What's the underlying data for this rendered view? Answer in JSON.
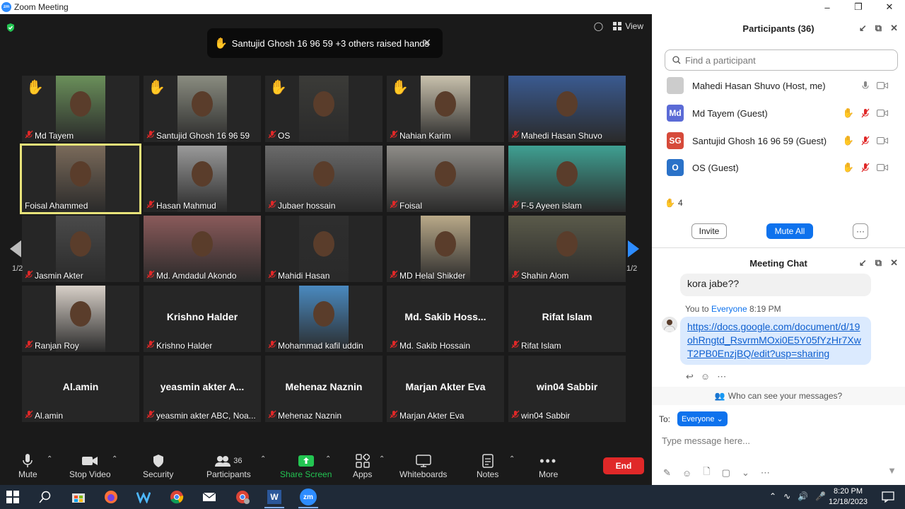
{
  "window": {
    "title": "Zoom Meeting",
    "logo": "zm"
  },
  "meeting": {
    "view_label": "View",
    "raised_banner": "Santujid Ghosh 16 96 59 +3 others raised hands",
    "page_left": "1/2",
    "page_right": "1/2",
    "tiles": [
      {
        "name": "Md Tayem",
        "hand": true,
        "video": true,
        "color": "#6a8f5a"
      },
      {
        "name": "Santujid Ghosh 16 96 59",
        "hand": true,
        "video": true,
        "color": "#8a8c80"
      },
      {
        "name": "OS",
        "hand": true,
        "video": true,
        "color": "#3b3b38"
      },
      {
        "name": "Nahian Karim",
        "hand": true,
        "video": true,
        "color": "#c9c1ad"
      },
      {
        "name": "Mahedi Hasan Shuvo",
        "hand": false,
        "video": true,
        "color": "#3a5a90"
      },
      {
        "name": "Foisal Ahammed",
        "hand": false,
        "video": true,
        "color": "#7a6a5a",
        "active": true
      },
      {
        "name": "Hasan Mahmud",
        "hand": false,
        "video": true,
        "color": "#9a9a9a"
      },
      {
        "name": "Jubaer hossain",
        "hand": false,
        "video": true,
        "color": "#6a6a6a"
      },
      {
        "name": "Foisal",
        "hand": false,
        "video": true,
        "color": "#8e8c88"
      },
      {
        "name": "F-5 Ayeen islam",
        "hand": false,
        "video": true,
        "color": "#3fa092"
      },
      {
        "name": "Jasmin Akter",
        "hand": false,
        "video": true,
        "color": "#4a4a4a"
      },
      {
        "name": "Md. Amdadul Akondo",
        "hand": false,
        "video": true,
        "color": "#8a5a5a"
      },
      {
        "name": "Mahidi Hasan",
        "hand": false,
        "video": true,
        "color": "#2e2e2e"
      },
      {
        "name": "MD Helal Shikder",
        "hand": false,
        "video": true,
        "color": "#b9a989"
      },
      {
        "name": "Shahin Alom",
        "hand": false,
        "video": true,
        "color": "#5a5a4a"
      },
      {
        "name": "Ranjan Roy",
        "hand": false,
        "video": true,
        "color": "#d8d0c8"
      },
      {
        "name": "Krishno Halder",
        "hand": false,
        "video": false,
        "big": "Krishno Halder"
      },
      {
        "name": "Mohammad kafil uddin",
        "hand": false,
        "video": true,
        "color": "#4a8ac0"
      },
      {
        "name": "Md. Sakib Hossain",
        "hand": false,
        "video": false,
        "big": "Md. Sakib Hoss..."
      },
      {
        "name": "Rifat Islam",
        "hand": false,
        "video": false,
        "big": "Rifat Islam"
      },
      {
        "name": "Al.amin",
        "hand": false,
        "video": false,
        "big": "Al.amin"
      },
      {
        "name": "yeasmin akter ABC, Noa...",
        "hand": false,
        "video": false,
        "big": "yeasmin akter A..."
      },
      {
        "name": "Mehenaz Naznin",
        "hand": false,
        "video": false,
        "big": "Mehenaz Naznin"
      },
      {
        "name": "Marjan Akter Eva",
        "hand": false,
        "video": false,
        "big": "Marjan Akter Eva"
      },
      {
        "name": "win04 Sabbir",
        "hand": false,
        "video": false,
        "big": "win04 Sabbir"
      }
    ]
  },
  "toolbar": {
    "mute": "Mute",
    "stop_video": "Stop Video",
    "security": "Security",
    "participants": "Participants",
    "participants_count": "36",
    "share_screen": "Share Screen",
    "apps": "Apps",
    "whiteboards": "Whiteboards",
    "notes": "Notes",
    "more": "More",
    "end": "End"
  },
  "participants_panel": {
    "title": "Participants (36)",
    "search_placeholder": "Find a participant",
    "rows": [
      {
        "name": "Mahedi Hasan Shuvo (Host, me)",
        "avatar": "",
        "color": "#cccccc",
        "hand": false
      },
      {
        "name": "Md Tayem (Guest)",
        "avatar": "Md",
        "color": "#5b6bd6",
        "hand": true
      },
      {
        "name": "Santujid Ghosh 16 96 59 (Guest)",
        "avatar": "SG",
        "color": "#d64a3a",
        "hand": true
      },
      {
        "name": "OS (Guest)",
        "avatar": "O",
        "color": "#2a72c8",
        "hand": true
      }
    ],
    "hands_count": "4",
    "invite": "Invite",
    "mute_all": "Mute All",
    "more": "···"
  },
  "chat_panel": {
    "title": "Meeting Chat",
    "prev_message": "kora jabe??",
    "me_label": "You to",
    "to_label": "Everyone",
    "time": "8:19 PM",
    "link": "https://docs.google.com/document/d/19ohRngtd_RsvrmMOxi0E5Y05fYzHr7XwT2PB0EnzjBQ/edit?usp=sharing",
    "who_can_see": "Who can see your messages?",
    "to_prefix": "To:",
    "to_select": "Everyone",
    "input_placeholder": "Type message here..."
  },
  "taskbar": {
    "time": "8:20 PM",
    "date": "12/18/2023",
    "word_label": "W",
    "zoom_label": "zm"
  },
  "colors": {
    "accent": "#0e72ed",
    "end": "#e02828",
    "active_border": "#e8e37a",
    "share": "#23c552"
  }
}
